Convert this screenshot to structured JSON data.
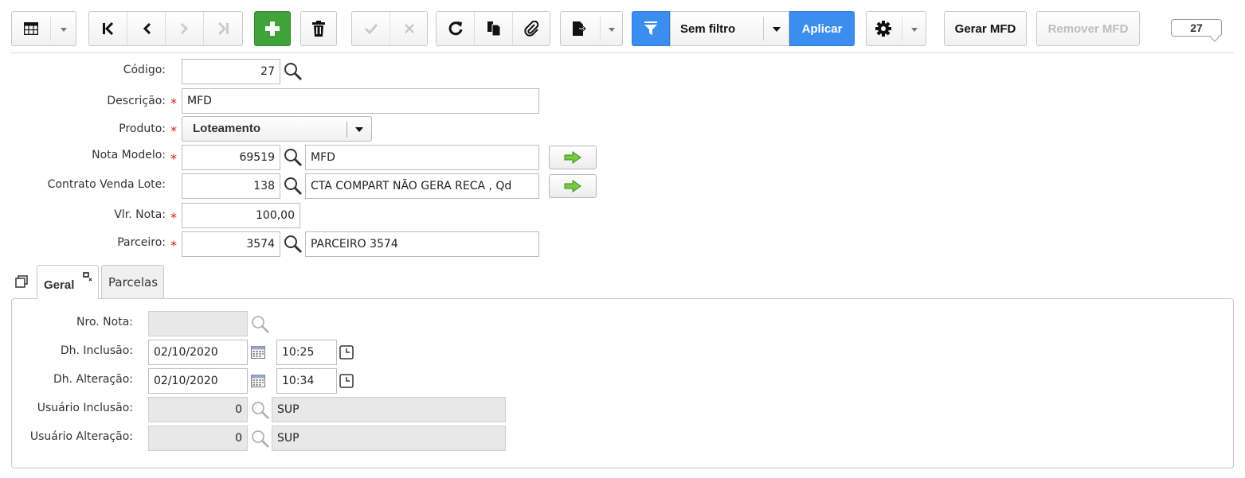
{
  "toolbar": {
    "filter_label": "Sem filtro",
    "apply_label": "Aplicar",
    "gerar_label": "Gerar MFD",
    "remover_label": "Remover MFD",
    "record_count": "27",
    "icons": [
      "grid-icon",
      "first-record-icon",
      "prev-record-icon",
      "next-record-icon",
      "last-record-icon",
      "add-icon",
      "trash-icon",
      "check-icon",
      "cancel-icon",
      "refresh-icon",
      "duplicate-icon",
      "attach-icon",
      "export-icon",
      "filter-icon",
      "gear-icon"
    ]
  },
  "form": {
    "codigo_label": "Código:",
    "codigo_value": "27",
    "descricao_label": "Descrição:",
    "descricao_value": "MFD",
    "produto_label": "Produto:",
    "produto_value": "Loteamento",
    "nota_modelo_label": "Nota Modelo:",
    "nota_modelo_code": "69519",
    "nota_modelo_desc": "MFD",
    "contrato_label": "Contrato Venda Lote:",
    "contrato_code": "138",
    "contrato_desc": "CTA COMPART NÃO GERA RECA , Qd",
    "vlr_nota_label": "Vlr. Nota:",
    "vlr_nota_value": "100,00",
    "parceiro_label": "Parceiro:",
    "parceiro_code": "3574",
    "parceiro_desc": "PARCEIRO 3574",
    "required_mark": "*"
  },
  "tabs": [
    {
      "label": "Geral"
    },
    {
      "label": "Parcelas"
    }
  ],
  "geral": {
    "nro_nota_label": "Nro. Nota:",
    "nro_nota_value": "",
    "dh_inclusao_label": "Dh. Inclusão:",
    "dh_inclusao_date": "02/10/2020",
    "dh_inclusao_time": "10:25",
    "dh_alteracao_label": "Dh. Alteração:",
    "dh_alteracao_date": "02/10/2020",
    "dh_alteracao_time": "10:34",
    "usuario_inclusao_label": "Usuário Inclusão:",
    "usuario_inclusao_code": "0",
    "usuario_inclusao_name": "SUP",
    "usuario_alteracao_label": "Usuário Alteração:",
    "usuario_alteracao_code": "0",
    "usuario_alteracao_name": "SUP"
  },
  "colors": {
    "green_button": "#3fa33a",
    "blue_button": "#3b8ef0",
    "required": "#d81e1e",
    "readonly_field": "#e8e8e8"
  }
}
